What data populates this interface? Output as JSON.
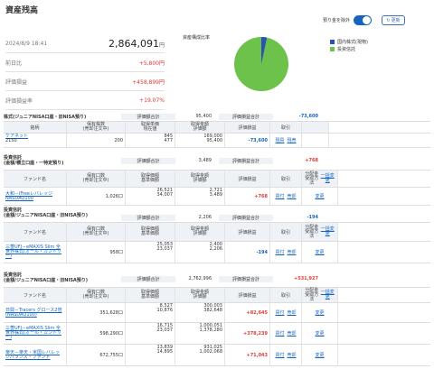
{
  "page": {
    "title": "資産残高",
    "date": "2024/8/9 18:41",
    "toggle_label": "預り金を除外",
    "refresh_label": "更新"
  },
  "summary": {
    "total": "2,864,091",
    "total_unit": "円",
    "rows": [
      {
        "label": "前日比",
        "value": "+5,800円"
      },
      {
        "label": "評価損益",
        "value": "+458,899円"
      },
      {
        "label": "評価損益率",
        "value": "+19.07%"
      }
    ]
  },
  "pie": {
    "title": "資産構成比率",
    "slices": [
      {
        "label": "国内株式(現物)",
        "value": 3.3,
        "color": "#2d4fb8"
      },
      {
        "label": "投資信託",
        "value": 96.7,
        "color": "#6cc24a"
      }
    ]
  },
  "stocks": {
    "title": "株式(ジュニアNISA口座・旧NISA預り)",
    "eval_label": "評価額合計",
    "eval": "95,400",
    "pl_label": "評価損益合計",
    "pl": "-73,600",
    "headers": [
      "銘柄",
      "保有株数\n(売却注文中)",
      "取得単価\n現在値",
      "取得金額\n評価額",
      "評価損益",
      "取引"
    ],
    "row": {
      "name": "ケアネット",
      "code": "2150",
      "shares": "200",
      "price1": "845",
      "price2": "477",
      "amt1": "169,000",
      "amt2": "95,400",
      "pl": "-73,600",
      "a1": "現買",
      "a2": "現売"
    }
  },
  "fund1": {
    "title1": "投資信託",
    "title2": "(金額/積立口座・一特定預り)",
    "eval_label": "評価額合計",
    "eval": "3,489",
    "pl_label": "評価損益合計",
    "pl": "+768",
    "headers": [
      "ファンド名",
      "保有口数\n(売却注文中)",
      "取得価額\n基準価額",
      "取得金額\n評価額",
      "評価損益",
      "取引",
      "分配金\n受取方法\n一括変更"
    ],
    "row": {
      "name": "大和－iFreeレバレッジ NASDAQ100",
      "units": "1,026口",
      "p1": "26,521",
      "p2": "34,007",
      "a1": "2,721",
      "a2": "3,489",
      "pl": "+768",
      "t1": "買付",
      "t2": "売却",
      "d": "変更"
    }
  },
  "fund2": {
    "title1": "投資信託",
    "title2": "(金額/ジュニアNISA口座・旧NISA預り)",
    "eval_label": "評価額合計",
    "eval": "2,206",
    "pl_label": "評価損益合計",
    "pl": "-194",
    "row": {
      "name": "三菱UFJ－eMAXIS Slim 全世界株式(オール・カントリー)",
      "units": "958口",
      "p1": "25,053",
      "p2": "23,037",
      "a1": "2,400",
      "a2": "2,206",
      "pl": "-194",
      "t1": "買付",
      "t2": "売却",
      "d": "変更"
    }
  },
  "fund3": {
    "title1": "投資信託",
    "title2": "(金額/ジュニアNISA口座・旧NISA預り)",
    "eval_label": "評価額合計",
    "eval": "2,762,996",
    "pl_label": "評価損益合計",
    "pl": "+531,927",
    "rows": [
      {
        "name": "日興－Tracers グロース2倍(NASDAQ100)",
        "units": "351,628口",
        "p1": "8,527",
        "p2": "10,876",
        "a1": "300,003",
        "a2": "382,648",
        "pl": "+82,645",
        "t1": "買付",
        "t2": "売却",
        "d": "変更"
      },
      {
        "name": "三菱UFJ－eMAXIS Slim 全世界株式(オール・カントリー)",
        "units": "598,290口",
        "p1": "16,715",
        "p2": "23,037",
        "a1": "1,000,051",
        "a2": "1,378,280",
        "pl": "+378,239",
        "t1": "買付",
        "t2": "売却",
        "d": "変更"
      },
      {
        "name": "楽天－楽天・米国レバレッジバランス・ファンド",
        "units": "672,755口",
        "p1": "13,839",
        "p2": "14,895",
        "a1": "931,025",
        "a2": "1,002,068",
        "pl": "+71,043",
        "t1": "買付",
        "t2": "売却",
        "d": "変更"
      }
    ]
  }
}
